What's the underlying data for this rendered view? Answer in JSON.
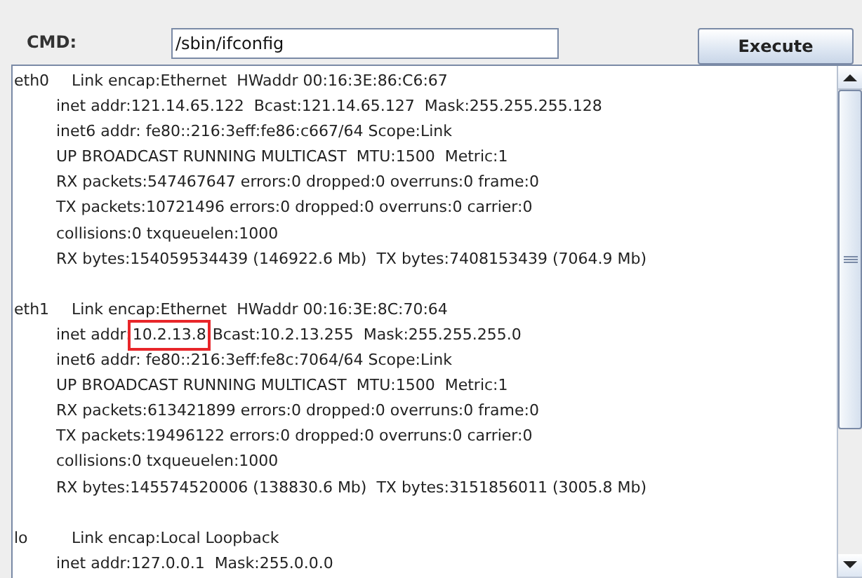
{
  "command_bar": {
    "label": "CMD:",
    "value": "/sbin/ifconfig",
    "button": "Execute"
  },
  "output": {
    "interfaces": [
      {
        "name": "eth0",
        "header": "Link encap:Ethernet  HWaddr 00:16:3E:86:C6:67",
        "lines": [
          {
            "text": "inet addr:121.14.65.122  Bcast:121.14.65.127  Mask:255.255.255.128"
          },
          {
            "text": "inet6 addr: fe80::216:3eff:fe86:c667/64 Scope:Link"
          },
          {
            "text": "UP BROADCAST RUNNING MULTICAST  MTU:1500  Metric:1"
          },
          {
            "text": "RX packets:547467647 errors:0 dropped:0 overruns:0 frame:0"
          },
          {
            "text": "TX packets:10721496 errors:0 dropped:0 overruns:0 carrier:0"
          },
          {
            "text": "collisions:0 txqueuelen:1000"
          },
          {
            "text": "RX bytes:154059534439 (146922.6 Mb)  TX bytes:7408153439 (7064.9 Mb)"
          }
        ]
      },
      {
        "name": "eth1",
        "header": "Link encap:Ethernet  HWaddr 00:16:3E:8C:70:64",
        "lines": [
          {
            "text": "inet addr:",
            "highlight": "10.2.13.8",
            "rest": " Bcast:10.2.13.255  Mask:255.255.255.0"
          },
          {
            "text": "inet6 addr: fe80::216:3eff:fe8c:7064/64 Scope:Link"
          },
          {
            "text": "UP BROADCAST RUNNING MULTICAST  MTU:1500  Metric:1"
          },
          {
            "text": "RX packets:613421899 errors:0 dropped:0 overruns:0 frame:0"
          },
          {
            "text": "TX packets:19496122 errors:0 dropped:0 overruns:0 carrier:0"
          },
          {
            "text": "collisions:0 txqueuelen:1000"
          },
          {
            "text": "RX bytes:145574520006 (138830.6 Mb)  TX bytes:3151856011 (3005.8 Mb)"
          }
        ]
      },
      {
        "name": "lo",
        "header": "Link encap:Local Loopback",
        "lines": [
          {
            "text": "inet addr:127.0.0.1  Mask:255.0.0.0"
          }
        ]
      }
    ]
  }
}
